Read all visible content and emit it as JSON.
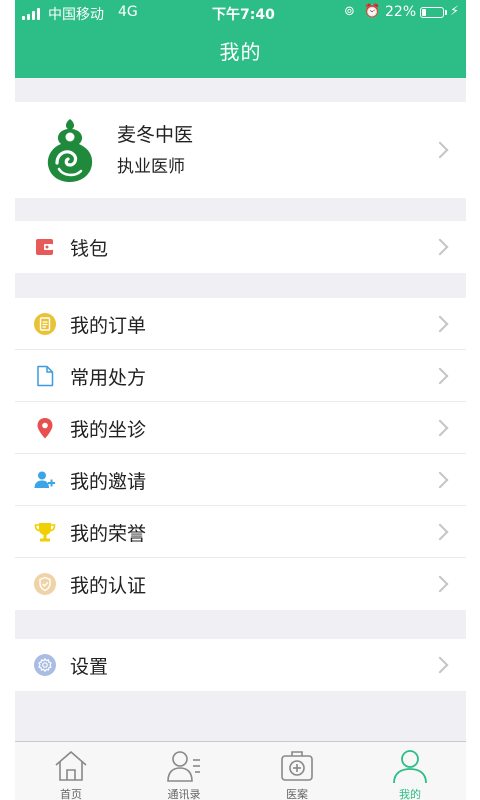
{
  "status_bar": {
    "carrier": "中国移动",
    "network": "4G",
    "time": "下午7:40",
    "battery_percent": "22%",
    "battery_level": 0.22
  },
  "header": {
    "title": "我的"
  },
  "profile": {
    "name": "麦冬中医",
    "role": "执业医师",
    "logo_icon": "gourd-logo-icon"
  },
  "menu": {
    "wallet": {
      "label": "钱包",
      "icon": "wallet-icon"
    },
    "orders": {
      "label": "我的订单",
      "icon": "clipboard-icon"
    },
    "prescriptions": {
      "label": "常用处方",
      "icon": "document-icon"
    },
    "clinic": {
      "label": "我的坐诊",
      "icon": "location-pin-icon"
    },
    "invite": {
      "label": "我的邀请",
      "icon": "add-user-icon"
    },
    "honors": {
      "label": "我的荣誉",
      "icon": "trophy-icon"
    },
    "certification": {
      "label": "我的认证",
      "icon": "shield-check-icon"
    },
    "settings": {
      "label": "设置",
      "icon": "gear-icon"
    }
  },
  "tabbar": {
    "home": "首页",
    "contacts": "通讯录",
    "cases": "医案",
    "mine": "我的",
    "active": "mine"
  },
  "colors": {
    "brand_green": "#2dbd86",
    "logo_green": "#1f8a3c",
    "wallet_red": "#e65a5a",
    "orders_yellow": "#e9c235",
    "doc_blue": "#3e9be0",
    "pin_red": "#e85050",
    "invite_blue": "#3aa6e8",
    "trophy_yellow": "#f0d000",
    "cert_tan": "#efd3a6",
    "settings_blue": "#a9bde4"
  }
}
